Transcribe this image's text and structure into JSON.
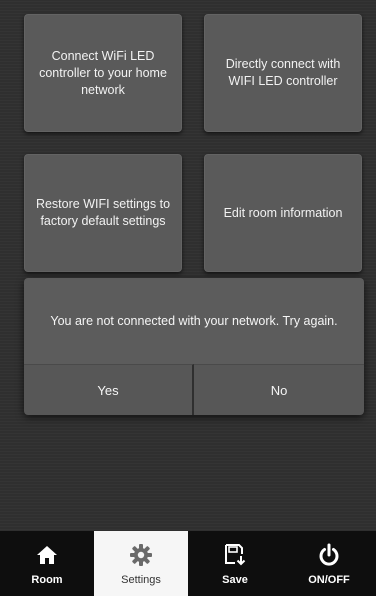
{
  "tiles": [
    {
      "label": "Connect WiFi LED controller to your home network"
    },
    {
      "label": "Directly connect with WIFI LED controller"
    },
    {
      "label": "Restore WIFI settings to factory default settings"
    },
    {
      "label": "Edit room information"
    }
  ],
  "dialog": {
    "message": "You are not connected with your network. Try again.",
    "yes_label": "Yes",
    "no_label": "No"
  },
  "tabbar": {
    "active": "Settings",
    "items": [
      {
        "label": "Room",
        "icon": "home-icon"
      },
      {
        "label": "Settings",
        "icon": "gear-icon"
      },
      {
        "label": "Save",
        "icon": "save-icon"
      },
      {
        "label": "ON/OFF",
        "icon": "power-icon"
      }
    ]
  },
  "colors": {
    "background": "#2f2f2f",
    "tile": "#5a5a5a",
    "tabbar": "#0e0e0e",
    "active_tab": "#f6f6f6"
  }
}
